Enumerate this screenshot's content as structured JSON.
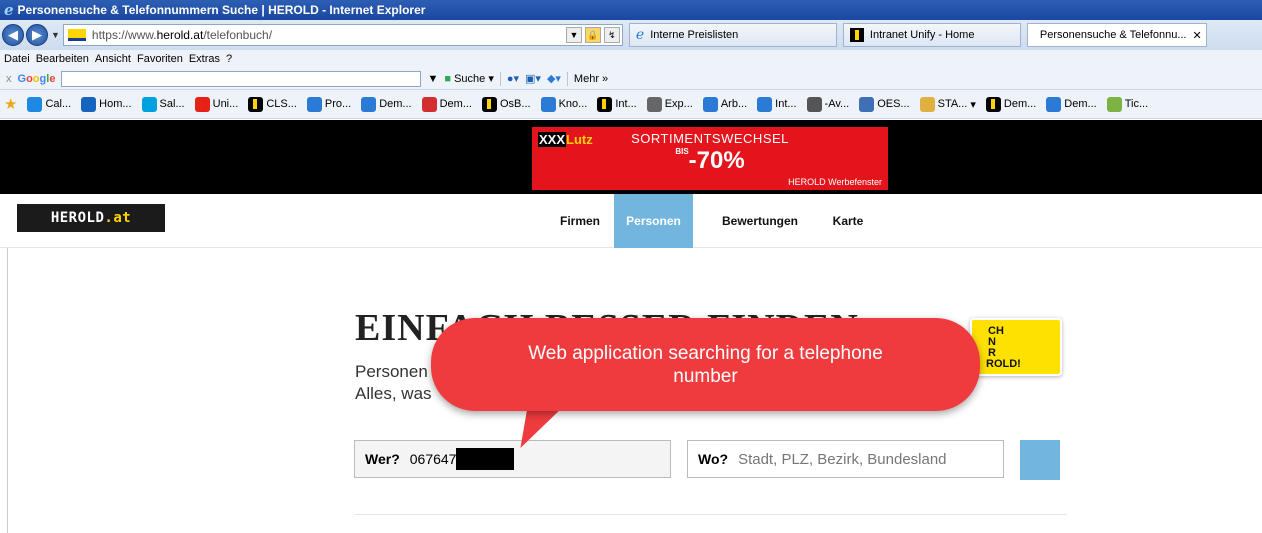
{
  "window": {
    "title": "Personensuche & Telefonnummern Suche | HEROLD - Internet Explorer"
  },
  "browser": {
    "url_prefix": "https://www.",
    "url_domain": "herold.at",
    "url_path": "/telefonbuch/",
    "tabs": [
      {
        "label": "Interne Preislisten",
        "icon": "ie-icon",
        "active": false
      },
      {
        "label": "Intranet Unify - Home",
        "icon": "unify-icon",
        "active": false
      },
      {
        "label": "Personensuche & Telefonnu...",
        "icon": "herold-icon",
        "active": true
      }
    ],
    "menu": [
      "Datei",
      "Bearbeiten",
      "Ansicht",
      "Favoriten",
      "Extras",
      "?"
    ],
    "google_toolbar": {
      "close": "x",
      "search_label": "Suche",
      "more_label": "Mehr »"
    },
    "favorites": [
      {
        "label": "Cal...",
        "color": "#1e88e5"
      },
      {
        "label": "Hom...",
        "color": "#1565c0"
      },
      {
        "label": "Sal...",
        "color": "#00a1e0"
      },
      {
        "label": "Uni...",
        "color": "#e62117"
      },
      {
        "label": "CLS...",
        "color": "#000000"
      },
      {
        "label": "Pro...",
        "color": "#2a7ad6"
      },
      {
        "label": "Dem...",
        "color": "#2a7ad6"
      },
      {
        "label": "Dem...",
        "color": "#d32f2f"
      },
      {
        "label": "OsB...",
        "color": "#000000"
      },
      {
        "label": "Kno...",
        "color": "#2a7ad6"
      },
      {
        "label": "Int...",
        "color": "#000000"
      },
      {
        "label": "Exp...",
        "color": "#666666"
      },
      {
        "label": "Arb...",
        "color": "#2a7ad6"
      },
      {
        "label": "Int...",
        "color": "#2a7ad6"
      },
      {
        "label": "-Av...",
        "color": "#555555"
      },
      {
        "label": "OES...",
        "color": "#3f6fb5"
      },
      {
        "label": "STA...",
        "color": "#e0b040"
      },
      {
        "label": "Dem...",
        "color": "#000000"
      },
      {
        "label": "Dem...",
        "color": "#2a7ad6"
      },
      {
        "label": "Tic...",
        "color": "#7cb342"
      }
    ]
  },
  "ad": {
    "brand_part1": "XXX",
    "brand_part2": "Lutz",
    "headline": "SORTIMENTSWECHSEL",
    "discount": "-70%",
    "discount_prefix": "BIS",
    "caption": "HEROLD Werbefenster"
  },
  "site": {
    "logo_text": "HEROLD",
    "logo_tld": ".at",
    "nav": [
      "Firmen",
      "Personen",
      "Bewertungen",
      "Karte"
    ],
    "active_nav": "Personen",
    "hero_title": "EINFACH BESSER FINDEN",
    "hero_sub1": "Personen",
    "hero_sub2": "Alles, was",
    "badge_lines": [
      "CH",
      "N",
      "R",
      "ROLD!"
    ],
    "search": {
      "wer_label": "Wer?",
      "wer_value": "067647",
      "wo_label": "Wo?",
      "wo_placeholder": "Stadt, PLZ, Bezirk, Bundesland"
    }
  },
  "callout": {
    "text": "Web application searching for a telephone number"
  },
  "colors": {
    "nav_active": "#72b5de",
    "callout": "#f03b3e",
    "ad_red": "#e3141c",
    "herold_yellow": "#ffd400"
  }
}
